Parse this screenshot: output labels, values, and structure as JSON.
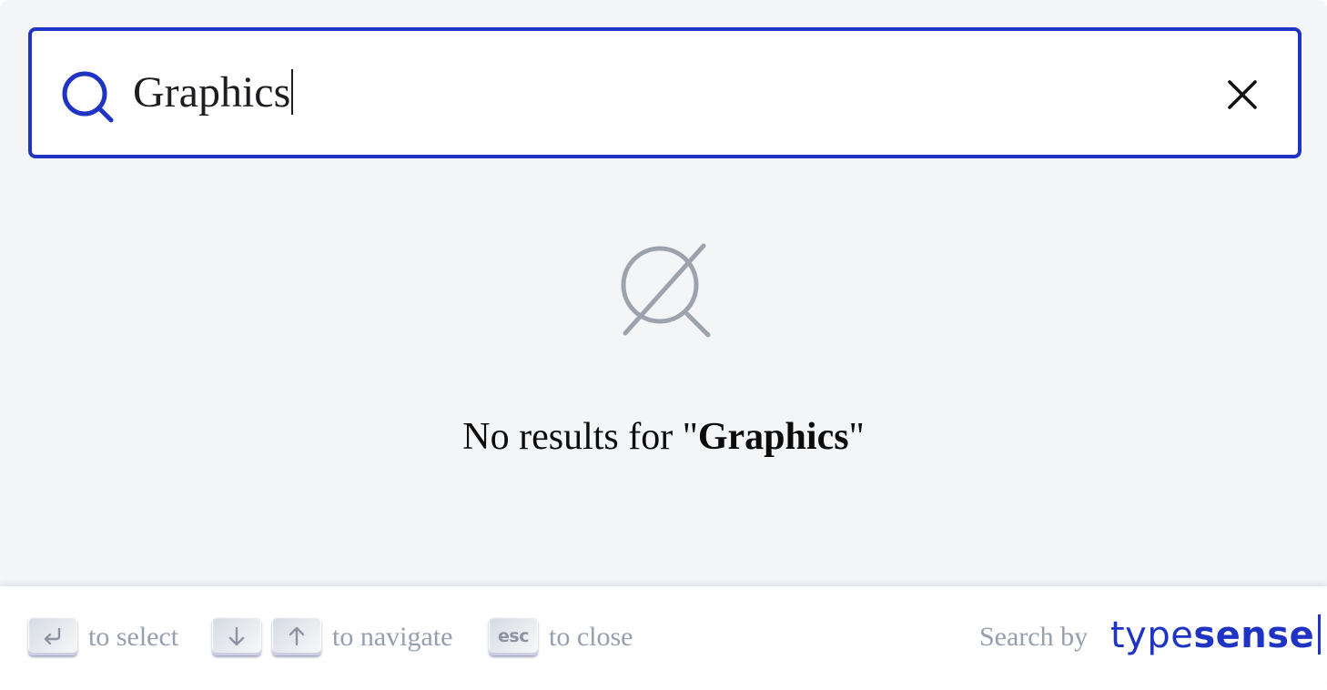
{
  "search": {
    "value": "Graphics",
    "clear_label": "Clear search"
  },
  "empty_state": {
    "prefix": "No results for \"",
    "query": "Graphics",
    "suffix": "\""
  },
  "footer": {
    "hints": [
      {
        "keys": [
          "enter-icon"
        ],
        "label": "to select"
      },
      {
        "keys": [
          "arrow-down-icon",
          "arrow-up-icon"
        ],
        "label": "to navigate"
      },
      {
        "keys": [
          "esc"
        ],
        "label": "to close"
      }
    ],
    "esc_key_label": "esc",
    "powered_by": "Search by",
    "brand": {
      "light": "type",
      "bold": "sense"
    }
  },
  "colors": {
    "accent": "#1f34c4",
    "background": "#f4f5f7",
    "muted": "#969faf",
    "icon_gray": "#9ca3af"
  }
}
